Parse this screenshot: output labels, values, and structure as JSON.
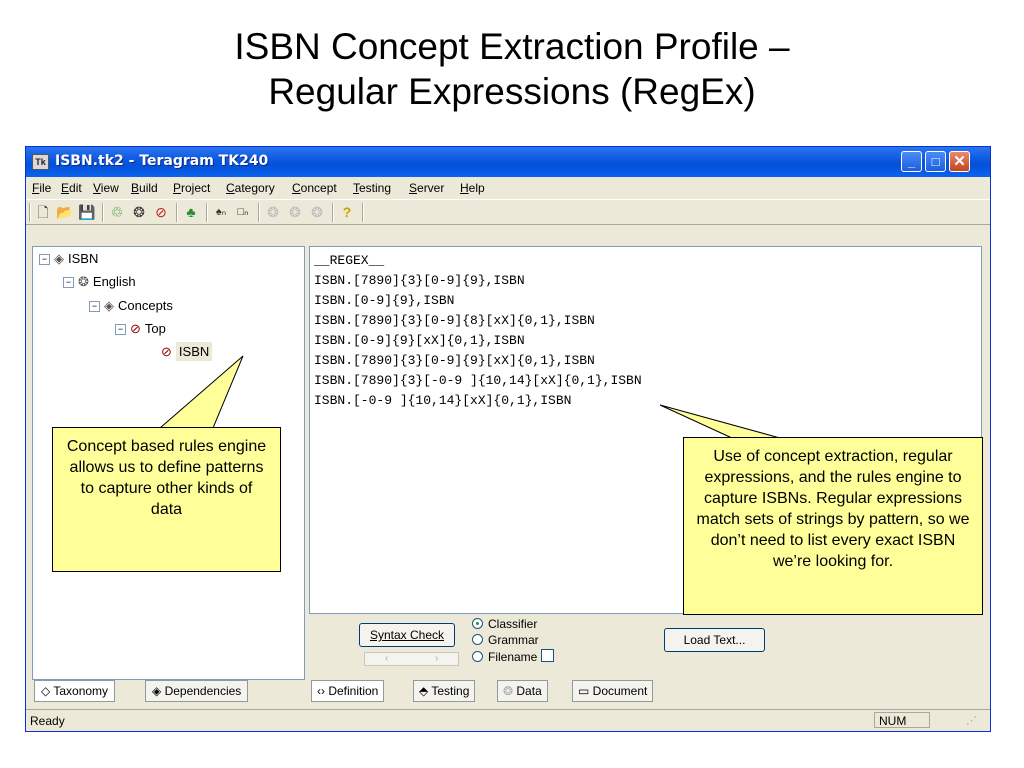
{
  "slide": {
    "title_line1": "ISBN Concept Extraction Profile –",
    "title_line2": "Regular Expressions (RegEx)"
  },
  "window": {
    "title": "ISBN.tk2 - Teragram TK240",
    "app_icon_text": "Tk",
    "controls": {
      "minimize": "_",
      "maximize": "□",
      "close": "✕"
    }
  },
  "menu": [
    "File",
    "Edit",
    "View",
    "Build",
    "Project",
    "Category",
    "Concept",
    "Testing",
    "Server",
    "Help"
  ],
  "tree": {
    "root": "ISBN",
    "language": "English",
    "concepts": "Concepts",
    "top": "Top",
    "leaf": "ISBN"
  },
  "left_tabs": [
    "Taxonomy",
    "Dependencies"
  ],
  "editor": {
    "lines": [
      "__REGEX__",
      "ISBN.[7890]{3}[0-9]{9},ISBN",
      "ISBN.[0-9]{9},ISBN",
      "ISBN.[7890]{3}[0-9]{8}[xX]{0,1},ISBN",
      "ISBN.[0-9]{9}[xX]{0,1},ISBN",
      "ISBN.[7890]{3}[0-9]{9}[xX]{0,1},ISBN",
      "ISBN.[7890]{3}[-0-9 ]{10,14}[xX]{0,1},ISBN",
      "ISBN.[-0-9 ]{10,14}[xX]{0,1},ISBN"
    ]
  },
  "controls": {
    "syntax_check": "Syntax Check",
    "radios": [
      {
        "label": "Classifier",
        "selected": true
      },
      {
        "label": "Grammar",
        "selected": false
      },
      {
        "label": "Filename",
        "selected": false
      }
    ],
    "load_text": "Load Text..."
  },
  "right_tabs": [
    "Definition",
    "Testing",
    "Data",
    "Document"
  ],
  "status": {
    "text": "Ready",
    "num": "NUM"
  },
  "callouts": {
    "left": "Concept based rules engine allows us to define patterns to capture other kinds of data",
    "right": "Use of concept extraction, regular expressions, and the rules engine to capture ISBNs. Regular expressions match sets of strings by pattern, so we don’t need to list every exact ISBN we’re looking for."
  },
  "colors": {
    "callout_fill": "#ffff99",
    "titlebar": "#0a58e0",
    "window_bg": "#ece9d8"
  }
}
